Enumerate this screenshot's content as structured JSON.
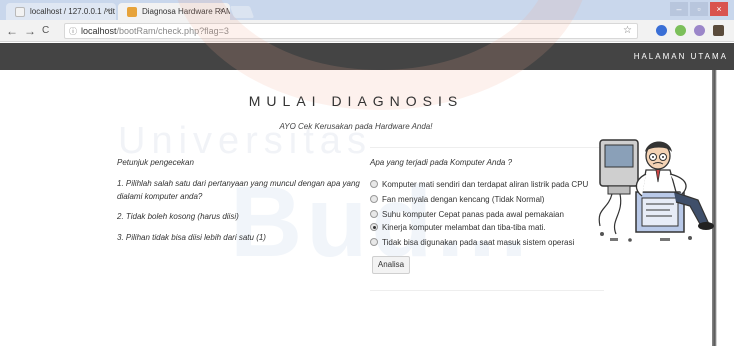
{
  "browser": {
    "tabs": [
      {
        "title": "localhost / 127.0.0.1 / dt"
      },
      {
        "title": "Diagnosa Hardware RAM"
      }
    ],
    "tab_close": "×",
    "address": {
      "host": "localhost",
      "path": "/bootRam/check.php?flag=3"
    },
    "nav": {
      "back": "←",
      "forward": "→",
      "reload": "C",
      "info": "ⓘ",
      "star": "☆"
    },
    "window_buttons": {
      "minimize": "–",
      "maximize": "▫",
      "close": "×"
    },
    "extension_icons": [
      "blue-extension-icon",
      "green-extension-icon",
      "purple-extension-icon",
      "film-extension-icon"
    ]
  },
  "site": {
    "home_link": "HALAMAN UTAMA"
  },
  "watermark": {
    "line1": "Universitas",
    "line2": "Bud..."
  },
  "main": {
    "title": "MULAI DIAGNOSIS",
    "subtitle": "AYO Cek Kerusakan pada Hardware Anda!"
  },
  "instructions": {
    "heading": "Petunjuk pengecekan",
    "items": [
      "1. Pilihlah salah satu dari pertanyaan yang muncul dengan apa yang dialami komputer anda?",
      "2. Tidak boleh kosong (harus diisi)",
      "3. Pilihan tidak bisa diisi lebih dari satu (1)"
    ]
  },
  "question": {
    "heading": "Apa yang terjadi pada Komputer Anda ?",
    "options": [
      {
        "label": "Komputer mati sendiri dan terdapat aliran listrik pada CPU",
        "checked": false
      },
      {
        "label": "Fan menyala dengan kencang (Tidak Normal)",
        "checked": false
      },
      {
        "label": "Suhu komputer Cepat panas pada awal pemakaian",
        "checked": false
      },
      {
        "label": "Kinerja komputer melambat dan tiba-tiba mati.",
        "checked": true
      },
      {
        "label": "Tidak bisa digunakan pada saat masuk sistem operasi",
        "checked": false
      }
    ],
    "submit_label": "Analisa"
  },
  "colors": {
    "header_bg": "#444444",
    "tab_bar": "#c9d7ec",
    "accent_tab": "#e7a33a"
  }
}
